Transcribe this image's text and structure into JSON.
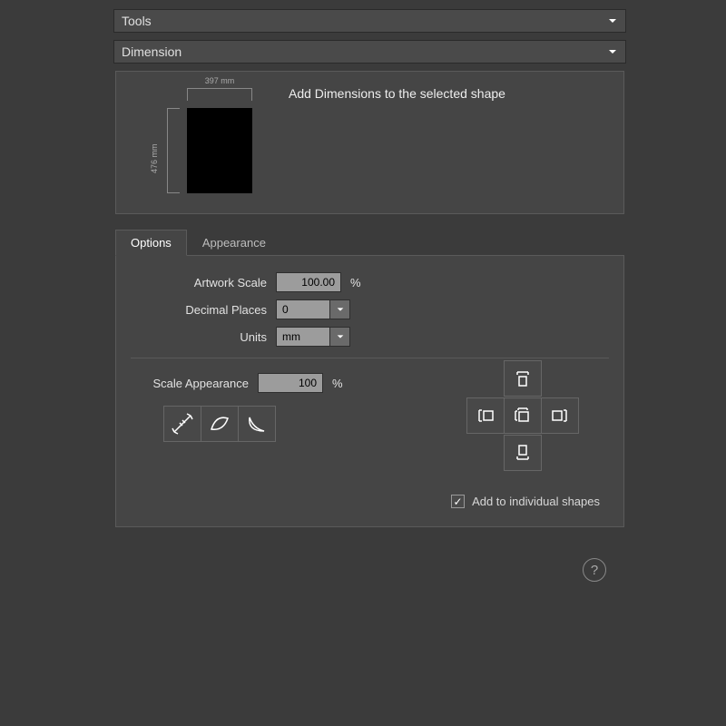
{
  "sections": {
    "tools_label": "Tools",
    "dimension_label": "Dimension"
  },
  "description": {
    "heading": "Add Dimensions to the selected shape",
    "thumb_width_label": "397 mm",
    "thumb_height_label": "476 mm"
  },
  "tabs": {
    "options": "Options",
    "appearance": "Appearance"
  },
  "options": {
    "artwork_scale_label": "Artwork Scale",
    "artwork_scale_value": "100.00",
    "artwork_scale_unit": "%",
    "decimal_places_label": "Decimal Places",
    "decimal_places_value": "0",
    "units_label": "Units",
    "units_value": "mm",
    "scale_appearance_label": "Scale Appearance",
    "scale_appearance_value": "100",
    "scale_appearance_unit": "%",
    "add_individual_label": "Add to individual shapes",
    "add_individual_checked": true
  },
  "icons": {
    "measure": "measure-line-icon",
    "curve1": "leaf-curve-icon",
    "curve2": "crescent-curve-icon",
    "place_top": "placement-top-icon",
    "place_left": "placement-left-icon",
    "place_center": "placement-center-icon",
    "place_right": "placement-right-icon",
    "place_bottom": "placement-bottom-icon",
    "help": "?"
  }
}
